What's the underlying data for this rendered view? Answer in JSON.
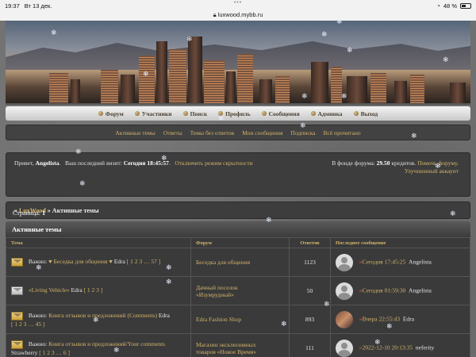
{
  "status": {
    "time": "19:37",
    "date": "Вт 13 дек.",
    "battery": "48 %",
    "url": "luxwood.mybb.ru"
  },
  "nav": [
    {
      "label": "Форум",
      "icon": "bullet-icon"
    },
    {
      "label": "Участники",
      "icon": "bullet-icon"
    },
    {
      "label": "Поиск",
      "icon": "bullet-icon"
    },
    {
      "label": "Профиль",
      "icon": "bullet-icon"
    },
    {
      "label": "Сообщения",
      "icon": "bullet-icon"
    },
    {
      "label": "Админка",
      "icon": "bullet-icon"
    },
    {
      "label": "Выход",
      "icon": "bullet-icon"
    }
  ],
  "subnav": [
    "Активные темы",
    "Ответы",
    "Темы без ответов",
    "Мои сообщения",
    "Подписка",
    "Всё прочитано"
  ],
  "welcome": {
    "greeting": "Привет,",
    "user": "Angelista",
    "last_visit_label": "Ваш последний визит:",
    "last_visit": "Сегодня 18:45:57",
    "hide_link": "Отключить режим скрытности",
    "fund_label": "В фонде форума:",
    "fund_value": "29.50",
    "fund_unit": "кредитов.",
    "help_link": "Помочь форуму.",
    "improved_link": "Улучшенный аккаунт"
  },
  "breadcrumb": {
    "sep": "»",
    "root": "LuxWood",
    "current": "Активные темы"
  },
  "pages": {
    "label": "Страница:",
    "value": "1"
  },
  "table": {
    "title": "Активные темы",
    "headers": {
      "topic": "Тема",
      "forum": "Форум",
      "replies": "Ответов",
      "last": "Последнее сообщение"
    },
    "rows": [
      {
        "icon": "sticky-topic-icon",
        "prefix": "Важно:",
        "title": "♥ Беседка для общения ♥",
        "author": "Edra",
        "pages": "[ 1 2 3 … 57 ]",
        "forum": "Беседка для общения",
        "forum2": "",
        "replies": "1123",
        "last_date": "Сегодня 17:45:25",
        "last_user": "Angelista",
        "avatar": "default-avatar-icon"
      },
      {
        "icon": "topic-icon",
        "prefix": "",
        "title": "«Living Vehicle»",
        "author": "Edra",
        "pages": "[ 1 2 3 ]",
        "forum": "Дачный поселок",
        "forum2": "«Изумрудный»",
        "replies": "50",
        "last_date": "Сегодня 01:59:30",
        "last_user": "Angelista",
        "avatar": "default-avatar-icon"
      },
      {
        "icon": "sticky-topic-icon",
        "prefix": "Важно:",
        "title": "Книга отзывов и предложений (Comments)",
        "author": "Edra",
        "pages": "[ 1 2 3 … 45 ]",
        "forum": "Edra Fashion Shop",
        "forum2": "",
        "replies": "893",
        "last_date": "Вчера 22:55:43",
        "last_user": "Edra",
        "avatar": "photo-avatar-icon"
      },
      {
        "icon": "sticky-topic-icon",
        "prefix": "Важно:",
        "title": "Книга отзывов и предложений/Your comments",
        "author": "Strawberry",
        "pages": "[ 1 2 3 … 6 ]",
        "forum": "Магазин эксклюзивных",
        "forum2": "товаров «Новое Время»",
        "replies": "111",
        "last_date": "2022-12-10 20:13:35",
        "last_user": "neferity",
        "avatar": "default-avatar-icon"
      }
    ]
  },
  "colors": {
    "accent": "#d3b46a",
    "panel": "#3d3d3d",
    "background": "#707070"
  }
}
